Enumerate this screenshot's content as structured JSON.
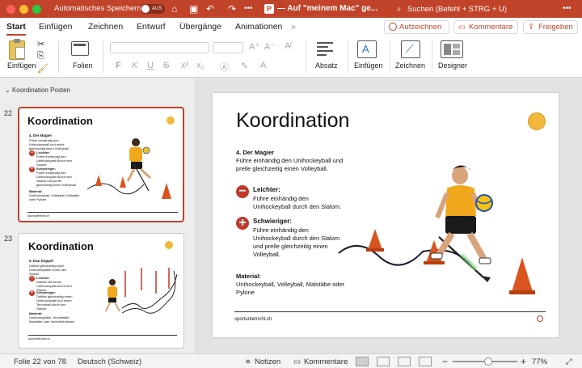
{
  "window": {
    "autosave_label": "Automatisches Speichern",
    "autosave_state": "AUS",
    "doc_title": "— Auf \"meinem Mac\" ge...",
    "search_placeholder": "Suchen (Befehl + STRG + U)"
  },
  "tabs": [
    "Start",
    "Einfügen",
    "Zeichnen",
    "Entwurf",
    "Übergänge",
    "Animationen"
  ],
  "tabs_more": "»",
  "actions": {
    "record": "Aufzeichnen",
    "comments": "Kommentare",
    "share": "Freigeben"
  },
  "ribbon": {
    "insert_label": "Einfügen",
    "slides_label": "Folien",
    "font_btns": [
      "F",
      "K",
      "U",
      "S",
      "x²",
      "x₂"
    ],
    "paragraph_label": "Absatz",
    "insert2_label": "Einfügen",
    "draw_label": "Zeichnen",
    "designer_label": "Designer"
  },
  "section_title": "Koordination Posten",
  "thumbnails": [
    {
      "num": "22",
      "title": "Koordination",
      "selected": true,
      "heading": "4. Der Magier",
      "intro": "Führe einhändig den Unihockeyball und prelle gleichzeitig einen Volleyball.",
      "easier_title": "Leichter:",
      "easier": "Führe einhändig den Unihockeyball durch den Slalom.",
      "harder_title": "Schwieriger:",
      "harder": "Führe einhändig den Unihockeyball durch den Slalom und prelle gleichzeitig einen Volleyball.",
      "material_title": "Material:",
      "material": "Unihockeyball, Volleyball, Malstäbe oder Pylone",
      "footer": "sportunterricht.ch"
    },
    {
      "num": "23",
      "title": "Koordination",
      "selected": false,
      "heading": "5. Das Doppel",
      "intro": "Dribble gleichzeitig zwei Unihockeybälle durch den Slalom.",
      "easier_title": "Leichter:",
      "easier": "Dribble mit einem Unihockeyball durch den Slalom.",
      "harder_title": "Schwieriger:",
      "harder": "Dribble gleichzeitig einen Unihockeyball und einen Tennisball durch den Slalom.",
      "material_title": "Material:",
      "material": "Unihockeybälle, Tennisbälle, Malstäbe oder Verkehrshütchen",
      "footer": "sportunterricht.ch"
    }
  ],
  "slide": {
    "title": "Koordination",
    "heading": "4. Der Magier",
    "intro_1": "Führe einhändig den Unihockeyball und",
    "intro_2": "prelle gleichzeitig einen Volleyball.",
    "easier_title": "Leichter:",
    "easier_1": "Führe einhändig den",
    "easier_2": "Unihockeyball durch den Slalom.",
    "harder_title": "Schwieriger:",
    "harder_1": "Führe einhändig den",
    "harder_2": "Unihockeyball durch den Slalom",
    "harder_3": "und prelle gleichzeitig einen",
    "harder_4": "Volleyball.",
    "material_title": "Material:",
    "material_1": "Unihockeyball, Volleyball, Malstäbe oder",
    "material_2": "Pylone",
    "footer": "sportunterricht.ch"
  },
  "status": {
    "slide_count": "Folie 22 von 78",
    "language": "Deutsch (Schweiz)",
    "notes": "Notizen",
    "comments": "Kommentare",
    "zoom": "77%",
    "zoom_fraction": 0.55
  },
  "colors": {
    "accent": "#c0432a",
    "red": "#c0392b",
    "cone": "#d9541e"
  }
}
